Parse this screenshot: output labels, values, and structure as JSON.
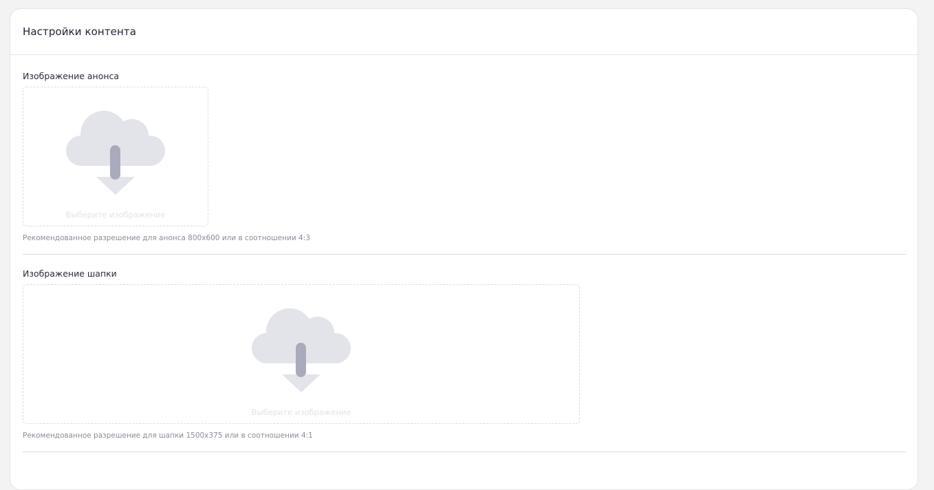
{
  "card": {
    "title": "Настройки контента"
  },
  "sections": [
    {
      "label": "Изображение анонса",
      "dropzone_text": "Выберите изображение",
      "hint": "Рекомендованное разрешение для анонса 800x600 или в соотношении 4:3",
      "icon": "cloud-download-icon"
    },
    {
      "label": "Изображение шапки",
      "dropzone_text": "Выберите изображение",
      "hint": "Рекомендованное разрешение для шапки 1500x375 или в соотношении 4:1",
      "icon": "cloud-download-icon"
    }
  ],
  "colors": {
    "background": "#f3f3f4",
    "card": "#ffffff",
    "cloud": "#e3e4ea",
    "arrow_shaft": "#a9aabb",
    "placeholder_text": "#e3e3ea",
    "hint_text": "#8a8c98"
  }
}
